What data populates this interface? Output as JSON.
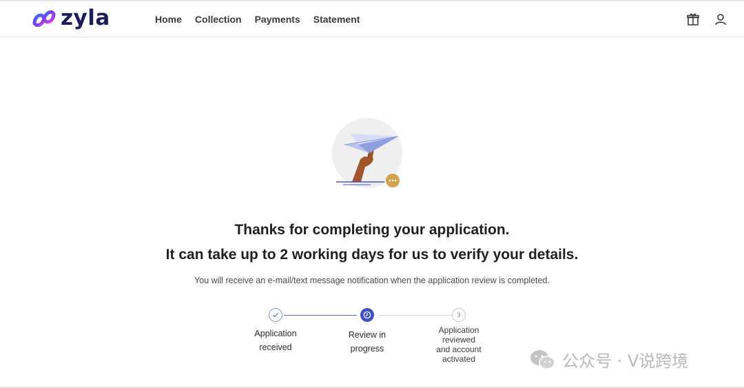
{
  "brand": {
    "name": "zyla",
    "accent": "#3e51c8"
  },
  "nav": {
    "items": [
      {
        "label": "Home"
      },
      {
        "label": "Collection"
      },
      {
        "label": "Payments"
      },
      {
        "label": "Statement"
      }
    ]
  },
  "header_icons": [
    "gift-icon",
    "user-icon"
  ],
  "confirmation": {
    "line1": "Thanks for completing your application.",
    "line2": "It can take up to 2 working days for us to verify your details.",
    "note": "You will receive an e-mail/text message notification when the application review is completed."
  },
  "steps": [
    {
      "lines": [
        "Application",
        "received"
      ],
      "state": "done"
    },
    {
      "lines": [
        "Review in",
        "progress"
      ],
      "state": "current"
    },
    {
      "number": "3",
      "lines": [
        "Application",
        "reviewed",
        "and account",
        "activated"
      ],
      "state": "pending"
    }
  ],
  "watermark": {
    "text": "公众号 · V说跨境"
  }
}
